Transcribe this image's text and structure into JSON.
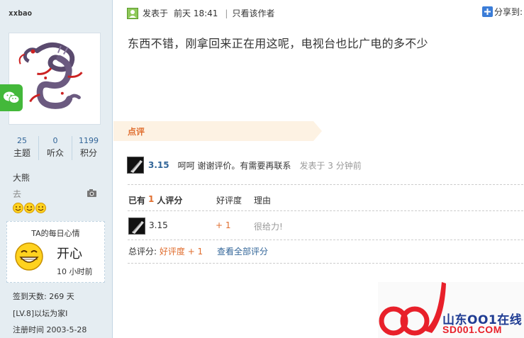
{
  "sidebar": {
    "username": "xxbao",
    "stats": [
      {
        "num": "25",
        "label": "主题"
      },
      {
        "num": "0",
        "label": "听众"
      },
      {
        "num": "1199",
        "label": "积分"
      }
    ],
    "title_name": "大熊",
    "title_sub": "去",
    "mood": {
      "title": "TA的每日心情",
      "text": "开心",
      "time": "10 小时前"
    },
    "info": [
      "签到天数: 269 天",
      "[LV.8]以坛为家I",
      "注册时间  2003-5-28"
    ]
  },
  "post": {
    "posted_label": "发表于",
    "posted_time": "前天  18:41",
    "author_only": "只看该作者",
    "share": "分享到",
    "body": "东西不错，刚拿回来正在用这呢，电视台也比广电的多不少"
  },
  "comments": {
    "tab_label": "点评",
    "items": [
      {
        "user": "3.15",
        "text": "呵呵 谢谢评价。有需要再联系",
        "time": "发表于 3 分钟前"
      }
    ]
  },
  "rating": {
    "head_prefix": "已有",
    "count": "1",
    "head_suffix": "人评分",
    "col_score": "好评度",
    "col_reason": "理由",
    "rows": [
      {
        "user": "3.15",
        "score": "+ 1",
        "reason": "很给力!"
      }
    ],
    "total_label": "总评分:",
    "total_value": "好评度 + 1",
    "view_all": "查看全部评分"
  },
  "watermark": {
    "line1": "山东OO1在线",
    "line2": "SD001.COM"
  },
  "colors": {
    "accent_orange": "#e06e2f",
    "link_blue": "#336699",
    "sidebar_bg": "#e5edf2"
  }
}
